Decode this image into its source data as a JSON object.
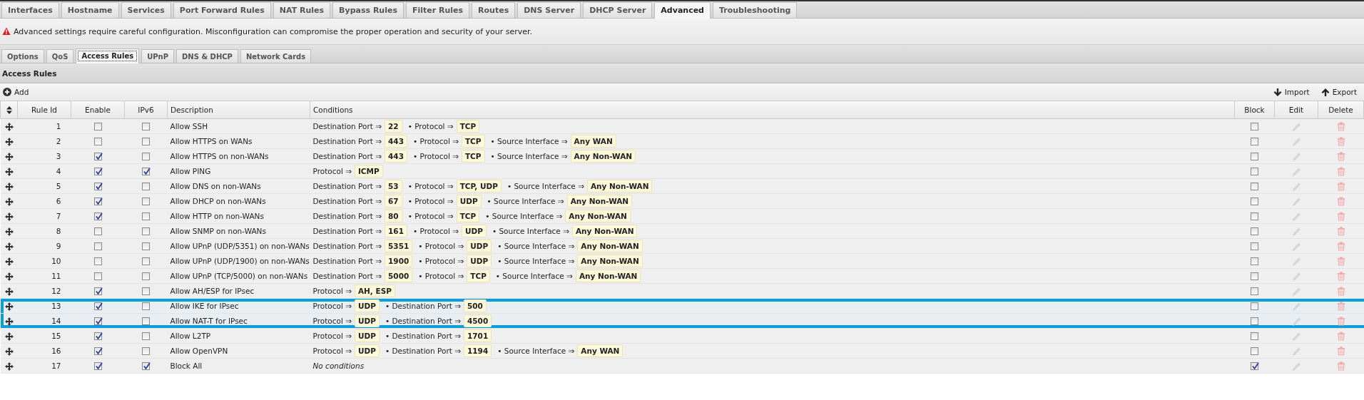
{
  "tabs": [
    {
      "label": "Interfaces",
      "selected": false
    },
    {
      "label": "Hostname",
      "selected": false
    },
    {
      "label": "Services",
      "selected": false
    },
    {
      "label": "Port Forward Rules",
      "selected": false
    },
    {
      "label": "NAT Rules",
      "selected": false
    },
    {
      "label": "Bypass Rules",
      "selected": false
    },
    {
      "label": "Filter Rules",
      "selected": false
    },
    {
      "label": "Routes",
      "selected": false
    },
    {
      "label": "DNS Server",
      "selected": false
    },
    {
      "label": "DHCP Server",
      "selected": false
    },
    {
      "label": "Advanced",
      "selected": true
    },
    {
      "label": "Troubleshooting",
      "selected": false
    }
  ],
  "warning": {
    "text": "Advanced settings require careful configuration. Misconfiguration can compromise the proper operation and security of your server."
  },
  "subtabs": [
    {
      "label": "Options",
      "selected": false
    },
    {
      "label": "QoS",
      "selected": false
    },
    {
      "label": "Access Rules",
      "selected": true
    },
    {
      "label": "UPnP",
      "selected": false
    },
    {
      "label": "DNS & DHCP",
      "selected": false
    },
    {
      "label": "Network Cards",
      "selected": false
    }
  ],
  "panel": {
    "title": "Access Rules",
    "add": "Add",
    "import": "Import",
    "export": "Export",
    "table": {
      "columns": [
        "Rule Id",
        "Enable",
        "IPv6",
        "Description",
        "Conditions",
        "Block",
        "Edit",
        "Delete"
      ],
      "rows": [
        {
          "rule_id": "1",
          "enable": false,
          "ipv6": false,
          "description": "Allow SSH",
          "conditions": [
            {
              "label": "Destination Port ⇒",
              "value": "22"
            },
            {
              "label": "• Protocol ⇒",
              "value": "TCP"
            }
          ],
          "block": false,
          "highlighted": false
        },
        {
          "rule_id": "2",
          "enable": false,
          "ipv6": false,
          "description": "Allow HTTPS on WANs",
          "conditions": [
            {
              "label": "Destination Port ⇒",
              "value": "443"
            },
            {
              "label": "• Protocol ⇒",
              "value": "TCP"
            },
            {
              "label": "• Source Interface ⇒",
              "value": "Any WAN"
            }
          ],
          "block": false,
          "highlighted": false
        },
        {
          "rule_id": "3",
          "enable": true,
          "ipv6": false,
          "description": "Allow HTTPS on non-WANs",
          "conditions": [
            {
              "label": "Destination Port ⇒",
              "value": "443"
            },
            {
              "label": "• Protocol ⇒",
              "value": "TCP"
            },
            {
              "label": "• Source Interface ⇒",
              "value": "Any Non-WAN"
            }
          ],
          "block": false,
          "highlighted": false
        },
        {
          "rule_id": "4",
          "enable": true,
          "ipv6": true,
          "description": "Allow PING",
          "conditions": [
            {
              "label": "Protocol ⇒",
              "value": "ICMP"
            }
          ],
          "block": false,
          "highlighted": false
        },
        {
          "rule_id": "5",
          "enable": true,
          "ipv6": false,
          "description": "Allow DNS on non-WANs",
          "conditions": [
            {
              "label": "Destination Port ⇒",
              "value": "53"
            },
            {
              "label": "• Protocol ⇒",
              "value": "TCP, UDP"
            },
            {
              "label": "• Source Interface ⇒",
              "value": "Any Non-WAN"
            }
          ],
          "block": false,
          "highlighted": false
        },
        {
          "rule_id": "6",
          "enable": true,
          "ipv6": false,
          "description": "Allow DHCP on non-WANs",
          "conditions": [
            {
              "label": "Destination Port ⇒",
              "value": "67"
            },
            {
              "label": "• Protocol ⇒",
              "value": "UDP"
            },
            {
              "label": "• Source Interface ⇒",
              "value": "Any Non-WAN"
            }
          ],
          "block": false,
          "highlighted": false
        },
        {
          "rule_id": "7",
          "enable": true,
          "ipv6": false,
          "description": "Allow HTTP on non-WANs",
          "conditions": [
            {
              "label": "Destination Port ⇒",
              "value": "80"
            },
            {
              "label": "• Protocol ⇒",
              "value": "TCP"
            },
            {
              "label": "• Source Interface ⇒",
              "value": "Any Non-WAN"
            }
          ],
          "block": false,
          "highlighted": false
        },
        {
          "rule_id": "8",
          "enable": false,
          "ipv6": false,
          "description": "Allow SNMP on non-WANs",
          "conditions": [
            {
              "label": "Destination Port ⇒",
              "value": "161"
            },
            {
              "label": "• Protocol ⇒",
              "value": "UDP"
            },
            {
              "label": "• Source Interface ⇒",
              "value": "Any Non-WAN"
            }
          ],
          "block": false,
          "highlighted": false
        },
        {
          "rule_id": "9",
          "enable": false,
          "ipv6": false,
          "description": "Allow UPnP (UDP/5351) on non-WANs",
          "conditions": [
            {
              "label": "Destination Port ⇒",
              "value": "5351"
            },
            {
              "label": "• Protocol ⇒",
              "value": "UDP"
            },
            {
              "label": "• Source Interface ⇒",
              "value": "Any Non-WAN"
            }
          ],
          "block": false,
          "highlighted": false
        },
        {
          "rule_id": "10",
          "enable": false,
          "ipv6": false,
          "description": "Allow UPnP (UDP/1900) on non-WANs",
          "conditions": [
            {
              "label": "Destination Port ⇒",
              "value": "1900"
            },
            {
              "label": "• Protocol ⇒",
              "value": "UDP"
            },
            {
              "label": "• Source Interface ⇒",
              "value": "Any Non-WAN"
            }
          ],
          "block": false,
          "highlighted": false
        },
        {
          "rule_id": "11",
          "enable": false,
          "ipv6": false,
          "description": "Allow UPnP (TCP/5000) on non-WANs",
          "conditions": [
            {
              "label": "Destination Port ⇒",
              "value": "5000"
            },
            {
              "label": "• Protocol ⇒",
              "value": "TCP"
            },
            {
              "label": "• Source Interface ⇒",
              "value": "Any Non-WAN"
            }
          ],
          "block": false,
          "highlighted": false
        },
        {
          "rule_id": "12",
          "enable": true,
          "ipv6": false,
          "description": "Allow AH/ESP for IPsec",
          "conditions": [
            {
              "label": "Protocol ⇒",
              "value": "AH, ESP"
            }
          ],
          "block": false,
          "highlighted": false
        },
        {
          "rule_id": "13",
          "enable": true,
          "ipv6": false,
          "description": "Allow IKE for IPsec",
          "conditions": [
            {
              "label": "Protocol ⇒",
              "value": "UDP"
            },
            {
              "label": "• Destination Port ⇒",
              "value": "500"
            }
          ],
          "block": false,
          "highlighted": true
        },
        {
          "rule_id": "14",
          "enable": true,
          "ipv6": false,
          "description": "Allow NAT-T for IPsec",
          "conditions": [
            {
              "label": "Protocol ⇒",
              "value": "UDP"
            },
            {
              "label": "• Destination Port ⇒",
              "value": "4500"
            }
          ],
          "block": false,
          "highlighted": true
        },
        {
          "rule_id": "15",
          "enable": true,
          "ipv6": false,
          "description": "Allow L2TP",
          "conditions": [
            {
              "label": "Protocol ⇒",
              "value": "UDP"
            },
            {
              "label": "• Destination Port ⇒",
              "value": "1701"
            }
          ],
          "block": false,
          "highlighted": false
        },
        {
          "rule_id": "16",
          "enable": true,
          "ipv6": false,
          "description": "Allow OpenVPN",
          "conditions": [
            {
              "label": "Protocol ⇒",
              "value": "UDP"
            },
            {
              "label": "• Destination Port ⇒",
              "value": "1194"
            },
            {
              "label": "• Source Interface ⇒",
              "value": "Any WAN"
            }
          ],
          "block": false,
          "highlighted": false
        },
        {
          "rule_id": "17",
          "enable": true,
          "ipv6": true,
          "description": "Block All",
          "conditions_note": "No conditions",
          "block": true,
          "highlighted": false
        }
      ]
    }
  }
}
